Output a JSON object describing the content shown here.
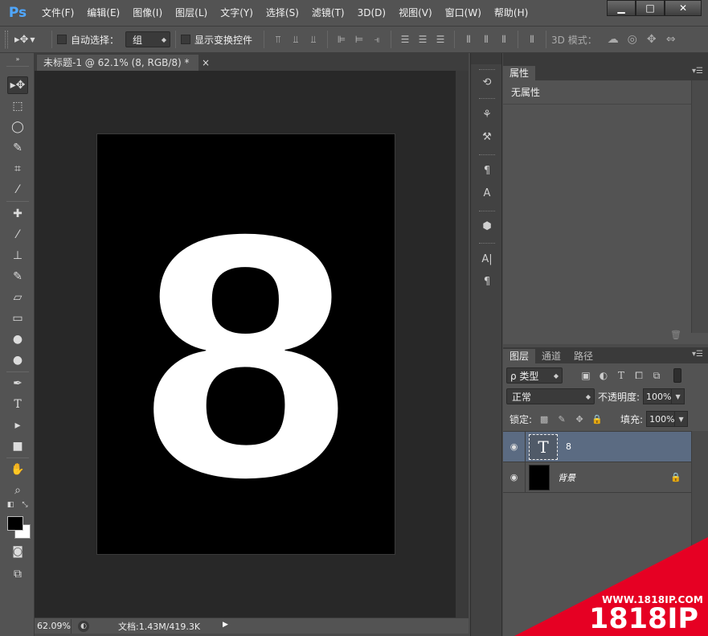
{
  "app": {
    "logo": "Ps",
    "brand_color": "#4fa7ff"
  },
  "menu": [
    "文件(F)",
    "编辑(E)",
    "图像(I)",
    "图层(L)",
    "文字(Y)",
    "选择(S)",
    "滤镜(T)",
    "3D(D)",
    "视图(V)",
    "窗口(W)",
    "帮助(H)"
  ],
  "window_controls": {
    "minimize": "▁",
    "maximize": "□",
    "close": "✕"
  },
  "options": {
    "auto_select_label": "自动选择：",
    "auto_select_value": "组",
    "show_transform_label": "显示变换控件",
    "mode_3d_label": "3D 模式："
  },
  "document": {
    "tab_title": "未标题-1 @ 62.1% (8, RGB/8) *",
    "tab_close": "×",
    "content_text": "8"
  },
  "status": {
    "zoom": "62.09%",
    "doc_info": "文档:1.43M/419.3K"
  },
  "properties": {
    "tab_label": "属性",
    "body_text": "无属性"
  },
  "layers_panel": {
    "tabs": [
      "图层",
      "通道",
      "路径"
    ],
    "filter_label": "ρ 类型",
    "blend_mode": "正常",
    "opacity_label": "不透明度:",
    "opacity_value": "100%",
    "lock_label": "锁定:",
    "fill_label": "填充:",
    "fill_value": "100%",
    "layers": [
      {
        "name": "8",
        "type": "text",
        "selected": true
      },
      {
        "name": "背景",
        "type": "background",
        "locked": true
      }
    ]
  },
  "watermark": {
    "url_text": "WWW.1818IP.COM",
    "brand": "1818IP",
    "color": "#e60023"
  }
}
